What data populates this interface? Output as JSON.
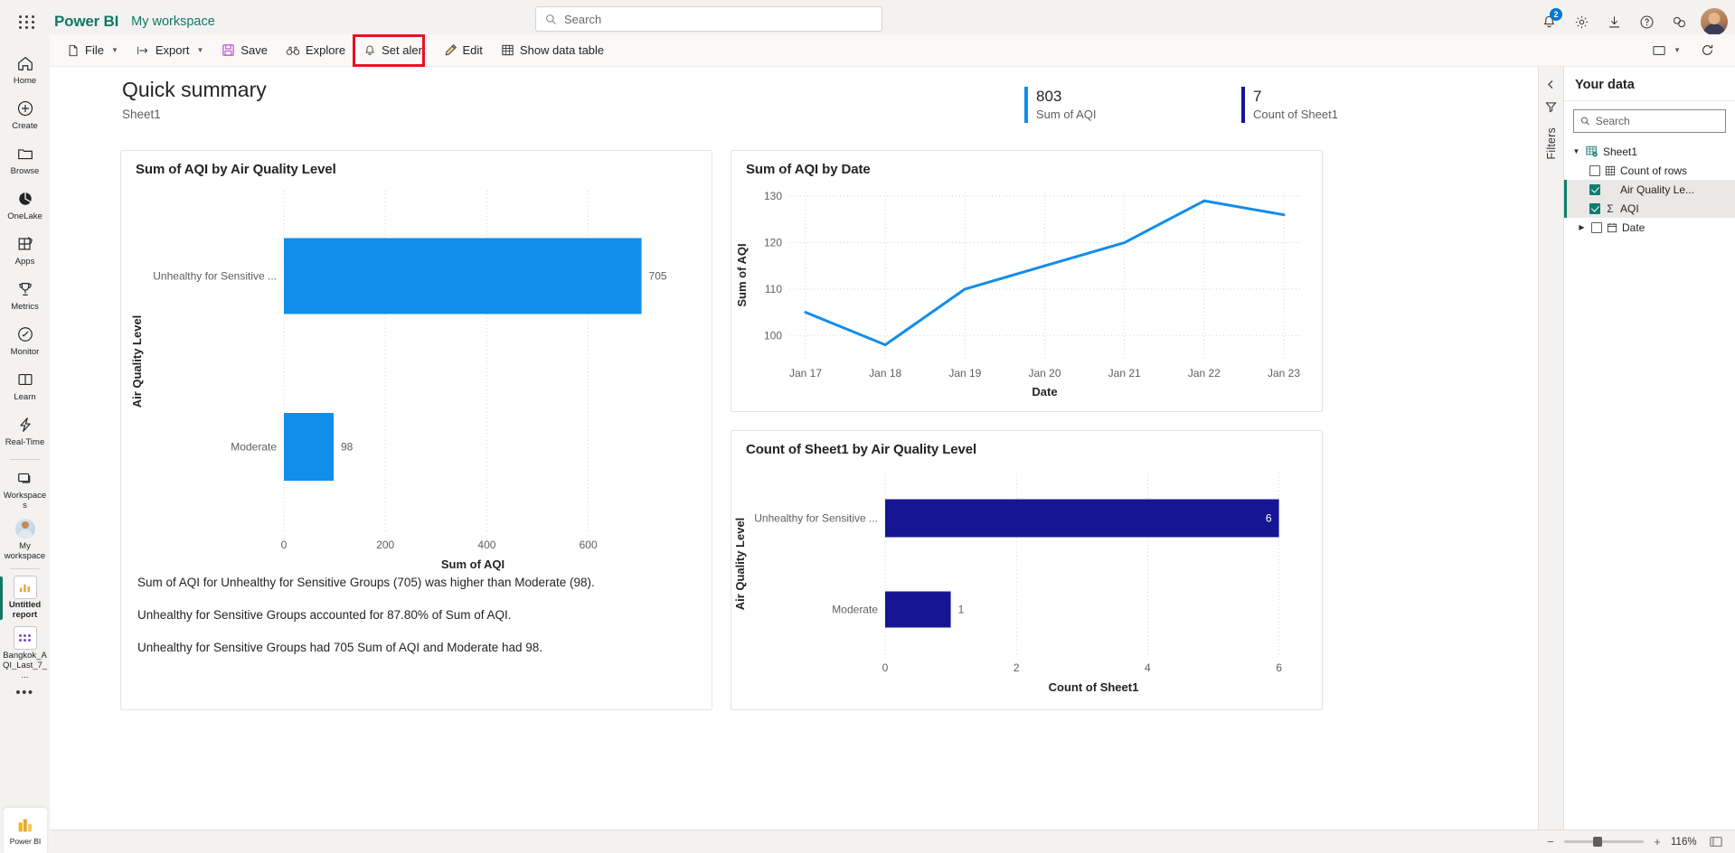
{
  "topbar": {
    "waffle_icon": "app-launcher-icon",
    "brand": "Power BI",
    "workspace": "My workspace",
    "search_placeholder": "Search",
    "notifications_badge": "2",
    "icons": [
      "bell-icon",
      "gear-icon",
      "download-icon",
      "question-icon",
      "feedback-icon",
      "avatar"
    ]
  },
  "commandbar": {
    "file": "File",
    "export": "Export",
    "save": "Save",
    "explore": "Explore",
    "set_alert": "Set alert",
    "edit": "Edit",
    "show_data_table": "Show data table",
    "view_label": "view-mode-icon",
    "refresh_label": "refresh-icon"
  },
  "sidebar": {
    "items": [
      {
        "label": "Home",
        "icon": "home-icon"
      },
      {
        "label": "Create",
        "icon": "plus-circle-icon"
      },
      {
        "label": "Browse",
        "icon": "folder-icon"
      },
      {
        "label": "OneLake",
        "icon": "onelake-icon"
      },
      {
        "label": "Apps",
        "icon": "apps-icon"
      },
      {
        "label": "Metrics",
        "icon": "trophy-icon"
      },
      {
        "label": "Monitor",
        "icon": "monitor-icon"
      },
      {
        "label": "Learn",
        "icon": "book-icon"
      },
      {
        "label": "Real-Time",
        "icon": "lightning-icon"
      },
      {
        "label": "Workspaces",
        "icon": "workspaces-icon"
      },
      {
        "label": "My workspace",
        "icon": "user-avatar-icon"
      },
      {
        "label": "Untitled report",
        "icon": "report-icon"
      },
      {
        "label": "Bangkok_AQI_Last_7_...",
        "icon": "dataset-icon"
      }
    ],
    "more": "•••",
    "footer": "Power BI"
  },
  "report": {
    "title": "Quick summary",
    "subtitle": "Sheet1",
    "kpis": [
      {
        "value": "803",
        "label": "Sum of AQI",
        "color": "#118dea"
      },
      {
        "value": "7",
        "label": "Count of Sheet1",
        "color": "#161694"
      }
    ]
  },
  "chart_data": [
    {
      "type": "bar",
      "orientation": "horizontal",
      "title": "Sum of AQI by Air Quality Level",
      "categories": [
        "Unhealthy for Sensitive ...",
        "Moderate"
      ],
      "values": [
        705,
        98
      ],
      "data_labels": [
        "705",
        "98"
      ],
      "xlabel": "Sum of AQI",
      "ylabel": "Air Quality Level",
      "xticks": [
        "0",
        "200",
        "400",
        "600"
      ],
      "xtick_values": [
        0,
        200,
        400,
        600
      ],
      "xlim": [
        0,
        705
      ],
      "color": "#118dea",
      "grid": true,
      "legend": "none",
      "insights": [
        "Sum of AQI for Unhealthy for Sensitive Groups (705) was higher than Moderate (98).",
        "Unhealthy for Sensitive Groups accounted for 87.80% of Sum of AQI.",
        "Unhealthy for Sensitive Groups had 705 Sum of AQI and Moderate had 98."
      ]
    },
    {
      "type": "line",
      "title": "Sum of AQI by Date",
      "x": [
        "Jan 17",
        "Jan 18",
        "Jan 19",
        "Jan 20",
        "Jan 21",
        "Jan 22",
        "Jan 23"
      ],
      "values": [
        105,
        98,
        110,
        115,
        120,
        129,
        126
      ],
      "xlabel": "Date",
      "ylabel": "Sum of AQI",
      "yticks": [
        "100",
        "110",
        "120",
        "130"
      ],
      "ytick_values": [
        100,
        110,
        120,
        130
      ],
      "ylim": [
        95,
        130
      ],
      "color": "#118dea",
      "grid": true,
      "legend": "none"
    },
    {
      "type": "bar",
      "orientation": "horizontal",
      "title": "Count of Sheet1 by Air Quality Level",
      "categories": [
        "Unhealthy for Sensitive ...",
        "Moderate"
      ],
      "values": [
        6,
        1
      ],
      "data_labels": [
        "6",
        "1"
      ],
      "xlabel": "Count of Sheet1",
      "ylabel": "Air Quality Level",
      "xticks": [
        "0",
        "2",
        "4",
        "6"
      ],
      "xtick_values": [
        0,
        2,
        4,
        6
      ],
      "xlim": [
        0,
        6
      ],
      "color": "#161694",
      "grid": true,
      "legend": "none"
    }
  ],
  "filters": {
    "collapse_icon": "chevron-left-icon",
    "label": "Filters",
    "filter_icon": "filter-icon"
  },
  "rightpane": {
    "title": "Your data",
    "search_placeholder": "Search",
    "tree": [
      {
        "label": "Sheet1",
        "level": 0,
        "icon": "table-icon",
        "expanded": true,
        "checked": null,
        "selected": false
      },
      {
        "label": "Count of rows",
        "level": 1,
        "icon": "count-icon",
        "checked": false,
        "selected": false
      },
      {
        "label": "Air Quality Le...",
        "level": 1,
        "icon": "",
        "checked": true,
        "selected": true
      },
      {
        "label": "AQI",
        "level": 1,
        "icon": "sigma-icon",
        "checked": true,
        "selected": true
      },
      {
        "label": "Date",
        "level": 1,
        "icon": "calendar-icon",
        "checked": false,
        "selected": false,
        "expandable": true
      }
    ]
  },
  "statusbar": {
    "zoom_out": "−",
    "zoom_in": "+",
    "zoom_percent": "116%",
    "fit_icon": "fit-to-page-icon"
  }
}
